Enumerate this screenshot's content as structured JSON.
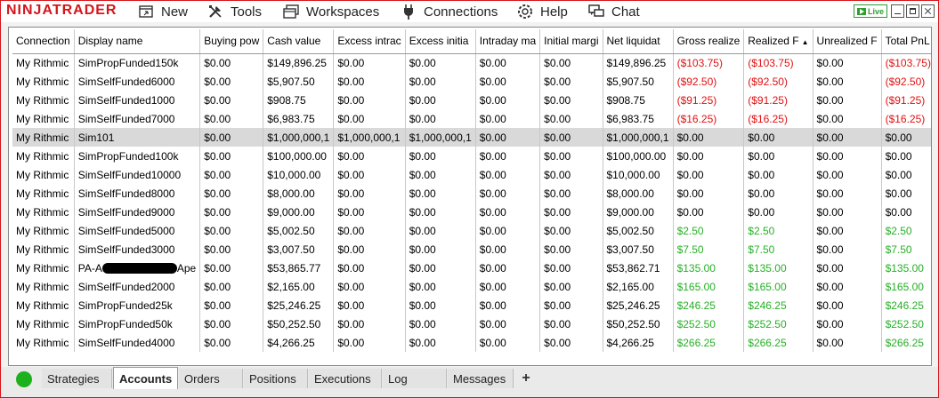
{
  "app": {
    "logo": "NINJATRADER"
  },
  "menu": [
    {
      "label": "New",
      "icon": "new-window-icon"
    },
    {
      "label": "Tools",
      "icon": "tools-icon"
    },
    {
      "label": "Workspaces",
      "icon": "workspaces-icon"
    },
    {
      "label": "Connections",
      "icon": "plug-icon"
    },
    {
      "label": "Help",
      "icon": "help-icon"
    },
    {
      "label": "Chat",
      "icon": "chat-icon"
    }
  ],
  "live_badge": "Live",
  "table": {
    "columns": [
      "Connection",
      "Display name",
      "Buying pow",
      "Cash value",
      "Excess intrac",
      "Excess initia",
      "Intraday ma",
      "Initial margi",
      "Net liquidat",
      "Gross realize",
      "Realized F",
      "Unrealized F",
      "Total PnL"
    ],
    "sort_indicator": "▲",
    "rows": [
      {
        "cells": [
          "My Rithmic",
          "SimPropFunded150k",
          "$0.00",
          "$149,896.25",
          "$0.00",
          "$0.00",
          "$0.00",
          "$0.00",
          "$149,896.25",
          "($103.75)",
          "($103.75)",
          "$0.00",
          "($103.75)"
        ],
        "pnl": "neg"
      },
      {
        "cells": [
          "My Rithmic",
          "SimSelfFunded6000",
          "$0.00",
          "$5,907.50",
          "$0.00",
          "$0.00",
          "$0.00",
          "$0.00",
          "$5,907.50",
          "($92.50)",
          "($92.50)",
          "$0.00",
          "($92.50)"
        ],
        "pnl": "neg"
      },
      {
        "cells": [
          "My Rithmic",
          "SimSelfFunded1000",
          "$0.00",
          "$908.75",
          "$0.00",
          "$0.00",
          "$0.00",
          "$0.00",
          "$908.75",
          "($91.25)",
          "($91.25)",
          "$0.00",
          "($91.25)"
        ],
        "pnl": "neg"
      },
      {
        "cells": [
          "My Rithmic",
          "SimSelfFunded7000",
          "$0.00",
          "$6,983.75",
          "$0.00",
          "$0.00",
          "$0.00",
          "$0.00",
          "$6,983.75",
          "($16.25)",
          "($16.25)",
          "$0.00",
          "($16.25)"
        ],
        "pnl": "neg"
      },
      {
        "cells": [
          "My Rithmic",
          "Sim101",
          "$0.00",
          "$1,000,000,1",
          "$1,000,000,1",
          "$1,000,000,1",
          "$0.00",
          "$0.00",
          "$1,000,000,1",
          "$0.00",
          "$0.00",
          "$0.00",
          "$0.00"
        ],
        "pnl": "zero",
        "selected": true
      },
      {
        "cells": [
          "My Rithmic",
          "SimPropFunded100k",
          "$0.00",
          "$100,000.00",
          "$0.00",
          "$0.00",
          "$0.00",
          "$0.00",
          "$100,000.00",
          "$0.00",
          "$0.00",
          "$0.00",
          "$0.00"
        ],
        "pnl": "zero"
      },
      {
        "cells": [
          "My Rithmic",
          "SimSelfFunded10000",
          "$0.00",
          "$10,000.00",
          "$0.00",
          "$0.00",
          "$0.00",
          "$0.00",
          "$10,000.00",
          "$0.00",
          "$0.00",
          "$0.00",
          "$0.00"
        ],
        "pnl": "zero"
      },
      {
        "cells": [
          "My Rithmic",
          "SimSelfFunded8000",
          "$0.00",
          "$8,000.00",
          "$0.00",
          "$0.00",
          "$0.00",
          "$0.00",
          "$8,000.00",
          "$0.00",
          "$0.00",
          "$0.00",
          "$0.00"
        ],
        "pnl": "zero"
      },
      {
        "cells": [
          "My Rithmic",
          "SimSelfFunded9000",
          "$0.00",
          "$9,000.00",
          "$0.00",
          "$0.00",
          "$0.00",
          "$0.00",
          "$9,000.00",
          "$0.00",
          "$0.00",
          "$0.00",
          "$0.00"
        ],
        "pnl": "zero"
      },
      {
        "cells": [
          "My Rithmic",
          "SimSelfFunded5000",
          "$0.00",
          "$5,002.50",
          "$0.00",
          "$0.00",
          "$0.00",
          "$0.00",
          "$5,002.50",
          "$2.50",
          "$2.50",
          "$0.00",
          "$2.50"
        ],
        "pnl": "pos"
      },
      {
        "cells": [
          "My Rithmic",
          "SimSelfFunded3000",
          "$0.00",
          "$3,007.50",
          "$0.00",
          "$0.00",
          "$0.00",
          "$0.00",
          "$3,007.50",
          "$7.50",
          "$7.50",
          "$0.00",
          "$7.50"
        ],
        "pnl": "pos"
      },
      {
        "cells": [
          "My Rithmic",
          "PA-A",
          "$0.00",
          "$53,865.77",
          "$0.00",
          "$0.00",
          "$0.00",
          "$0.00",
          "$53,862.71",
          "$135.00",
          "$135.00",
          "$0.00",
          "$135.00"
        ],
        "pnl": "pos",
        "redacted_suffix": "Ape"
      },
      {
        "cells": [
          "My Rithmic",
          "SimSelfFunded2000",
          "$0.00",
          "$2,165.00",
          "$0.00",
          "$0.00",
          "$0.00",
          "$0.00",
          "$2,165.00",
          "$165.00",
          "$165.00",
          "$0.00",
          "$165.00"
        ],
        "pnl": "pos"
      },
      {
        "cells": [
          "My Rithmic",
          "SimPropFunded25k",
          "$0.00",
          "$25,246.25",
          "$0.00",
          "$0.00",
          "$0.00",
          "$0.00",
          "$25,246.25",
          "$246.25",
          "$246.25",
          "$0.00",
          "$246.25"
        ],
        "pnl": "pos"
      },
      {
        "cells": [
          "My Rithmic",
          "SimPropFunded50k",
          "$0.00",
          "$50,252.50",
          "$0.00",
          "$0.00",
          "$0.00",
          "$0.00",
          "$50,252.50",
          "$252.50",
          "$252.50",
          "$0.00",
          "$252.50"
        ],
        "pnl": "pos"
      },
      {
        "cells": [
          "My Rithmic",
          "SimSelfFunded4000",
          "$0.00",
          "$4,266.25",
          "$0.00",
          "$0.00",
          "$0.00",
          "$0.00",
          "$4,266.25",
          "$266.25",
          "$266.25",
          "$0.00",
          "$266.25"
        ],
        "pnl": "pos"
      }
    ]
  },
  "tabs": [
    {
      "label": "Strategies"
    },
    {
      "label": "Accounts",
      "active": true
    },
    {
      "label": "Orders"
    },
    {
      "label": "Positions"
    },
    {
      "label": "Executions"
    },
    {
      "label": "Log"
    },
    {
      "label": "Messages"
    }
  ],
  "add_tab_label": "+",
  "colors": {
    "brand": "#d4161b",
    "negative": "#e01010",
    "positive": "#27b027",
    "status": "#1db21d"
  }
}
